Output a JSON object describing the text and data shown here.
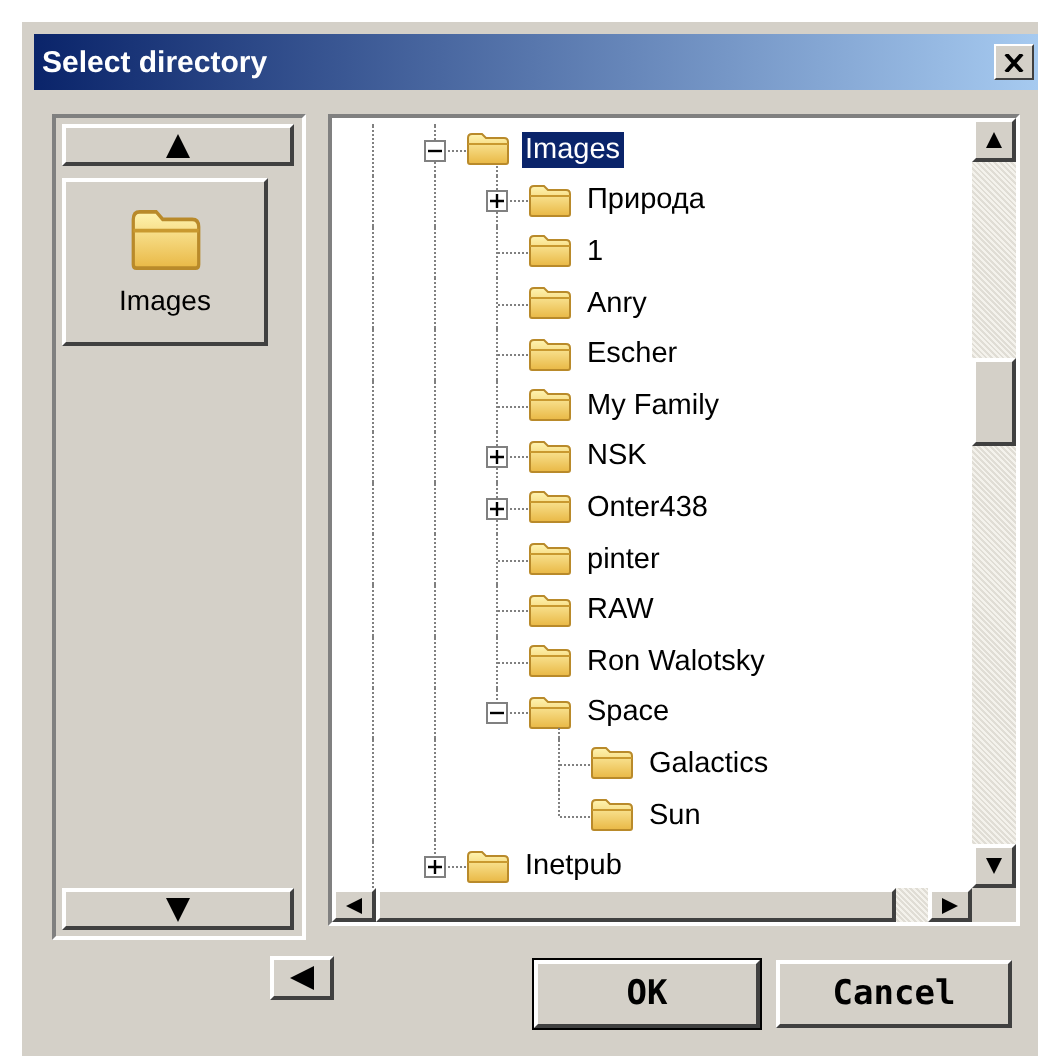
{
  "window": {
    "title": "Select directory"
  },
  "left_panel": {
    "current_folder": {
      "label": "Images"
    }
  },
  "tree": [
    {
      "label": "Images",
      "expanded": true,
      "selected": true,
      "children": [
        {
          "label": "Природа",
          "expanded": false,
          "selected": false
        },
        {
          "label": "1",
          "selected": false
        },
        {
          "label": "Anry",
          "selected": false
        },
        {
          "label": "Escher",
          "selected": false
        },
        {
          "label": "My Family",
          "selected": false
        },
        {
          "label": "NSK",
          "expanded": false,
          "selected": false
        },
        {
          "label": "Onter438",
          "expanded": false,
          "selected": false
        },
        {
          "label": "pinter",
          "selected": false
        },
        {
          "label": "RAW",
          "selected": false
        },
        {
          "label": "Ron Walotsky",
          "selected": false
        },
        {
          "label": "Space",
          "expanded": true,
          "selected": false,
          "children": [
            {
              "label": "Galactics",
              "selected": false
            },
            {
              "label": "Sun",
              "selected": false
            }
          ]
        }
      ]
    },
    {
      "label": "Inetpub",
      "expanded": false,
      "selected": false
    }
  ],
  "buttons": [
    "OK",
    "Cancel"
  ]
}
